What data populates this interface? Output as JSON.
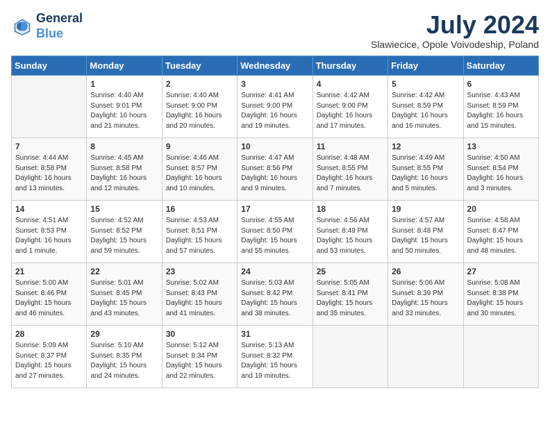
{
  "logo": {
    "line1": "General",
    "line2": "Blue"
  },
  "title": "July 2024",
  "subtitle": "Slawiecice, Opole Voivodeship, Poland",
  "days_of_week": [
    "Sunday",
    "Monday",
    "Tuesday",
    "Wednesday",
    "Thursday",
    "Friday",
    "Saturday"
  ],
  "weeks": [
    [
      {
        "day": "",
        "content": ""
      },
      {
        "day": "1",
        "content": "Sunrise: 4:40 AM\nSunset: 9:01 PM\nDaylight: 16 hours\nand 21 minutes."
      },
      {
        "day": "2",
        "content": "Sunrise: 4:40 AM\nSunset: 9:00 PM\nDaylight: 16 hours\nand 20 minutes."
      },
      {
        "day": "3",
        "content": "Sunrise: 4:41 AM\nSunset: 9:00 PM\nDaylight: 16 hours\nand 19 minutes."
      },
      {
        "day": "4",
        "content": "Sunrise: 4:42 AM\nSunset: 9:00 PM\nDaylight: 16 hours\nand 17 minutes."
      },
      {
        "day": "5",
        "content": "Sunrise: 4:42 AM\nSunset: 8:59 PM\nDaylight: 16 hours\nand 16 minutes."
      },
      {
        "day": "6",
        "content": "Sunrise: 4:43 AM\nSunset: 8:59 PM\nDaylight: 16 hours\nand 15 minutes."
      }
    ],
    [
      {
        "day": "7",
        "content": "Sunrise: 4:44 AM\nSunset: 8:58 PM\nDaylight: 16 hours\nand 13 minutes."
      },
      {
        "day": "8",
        "content": "Sunrise: 4:45 AM\nSunset: 8:58 PM\nDaylight: 16 hours\nand 12 minutes."
      },
      {
        "day": "9",
        "content": "Sunrise: 4:46 AM\nSunset: 8:57 PM\nDaylight: 16 hours\nand 10 minutes."
      },
      {
        "day": "10",
        "content": "Sunrise: 4:47 AM\nSunset: 8:56 PM\nDaylight: 16 hours\nand 9 minutes."
      },
      {
        "day": "11",
        "content": "Sunrise: 4:48 AM\nSunset: 8:55 PM\nDaylight: 16 hours\nand 7 minutes."
      },
      {
        "day": "12",
        "content": "Sunrise: 4:49 AM\nSunset: 8:55 PM\nDaylight: 16 hours\nand 5 minutes."
      },
      {
        "day": "13",
        "content": "Sunrise: 4:50 AM\nSunset: 8:54 PM\nDaylight: 16 hours\nand 3 minutes."
      }
    ],
    [
      {
        "day": "14",
        "content": "Sunrise: 4:51 AM\nSunset: 8:53 PM\nDaylight: 16 hours\nand 1 minute."
      },
      {
        "day": "15",
        "content": "Sunrise: 4:52 AM\nSunset: 8:52 PM\nDaylight: 15 hours\nand 59 minutes."
      },
      {
        "day": "16",
        "content": "Sunrise: 4:53 AM\nSunset: 8:51 PM\nDaylight: 15 hours\nand 57 minutes."
      },
      {
        "day": "17",
        "content": "Sunrise: 4:55 AM\nSunset: 8:50 PM\nDaylight: 15 hours\nand 55 minutes."
      },
      {
        "day": "18",
        "content": "Sunrise: 4:56 AM\nSunset: 8:49 PM\nDaylight: 15 hours\nand 53 minutes."
      },
      {
        "day": "19",
        "content": "Sunrise: 4:57 AM\nSunset: 8:48 PM\nDaylight: 15 hours\nand 50 minutes."
      },
      {
        "day": "20",
        "content": "Sunrise: 4:58 AM\nSunset: 8:47 PM\nDaylight: 15 hours\nand 48 minutes."
      }
    ],
    [
      {
        "day": "21",
        "content": "Sunrise: 5:00 AM\nSunset: 8:46 PM\nDaylight: 15 hours\nand 46 minutes."
      },
      {
        "day": "22",
        "content": "Sunrise: 5:01 AM\nSunset: 8:45 PM\nDaylight: 15 hours\nand 43 minutes."
      },
      {
        "day": "23",
        "content": "Sunrise: 5:02 AM\nSunset: 8:43 PM\nDaylight: 15 hours\nand 41 minutes."
      },
      {
        "day": "24",
        "content": "Sunrise: 5:03 AM\nSunset: 8:42 PM\nDaylight: 15 hours\nand 38 minutes."
      },
      {
        "day": "25",
        "content": "Sunrise: 5:05 AM\nSunset: 8:41 PM\nDaylight: 15 hours\nand 35 minutes."
      },
      {
        "day": "26",
        "content": "Sunrise: 5:06 AM\nSunset: 8:39 PM\nDaylight: 15 hours\nand 33 minutes."
      },
      {
        "day": "27",
        "content": "Sunrise: 5:08 AM\nSunset: 8:38 PM\nDaylight: 15 hours\nand 30 minutes."
      }
    ],
    [
      {
        "day": "28",
        "content": "Sunrise: 5:09 AM\nSunset: 8:37 PM\nDaylight: 15 hours\nand 27 minutes."
      },
      {
        "day": "29",
        "content": "Sunrise: 5:10 AM\nSunset: 8:35 PM\nDaylight: 15 hours\nand 24 minutes."
      },
      {
        "day": "30",
        "content": "Sunrise: 5:12 AM\nSunset: 8:34 PM\nDaylight: 15 hours\nand 22 minutes."
      },
      {
        "day": "31",
        "content": "Sunrise: 5:13 AM\nSunset: 8:32 PM\nDaylight: 15 hours\nand 19 minutes."
      },
      {
        "day": "",
        "content": ""
      },
      {
        "day": "",
        "content": ""
      },
      {
        "day": "",
        "content": ""
      }
    ]
  ]
}
